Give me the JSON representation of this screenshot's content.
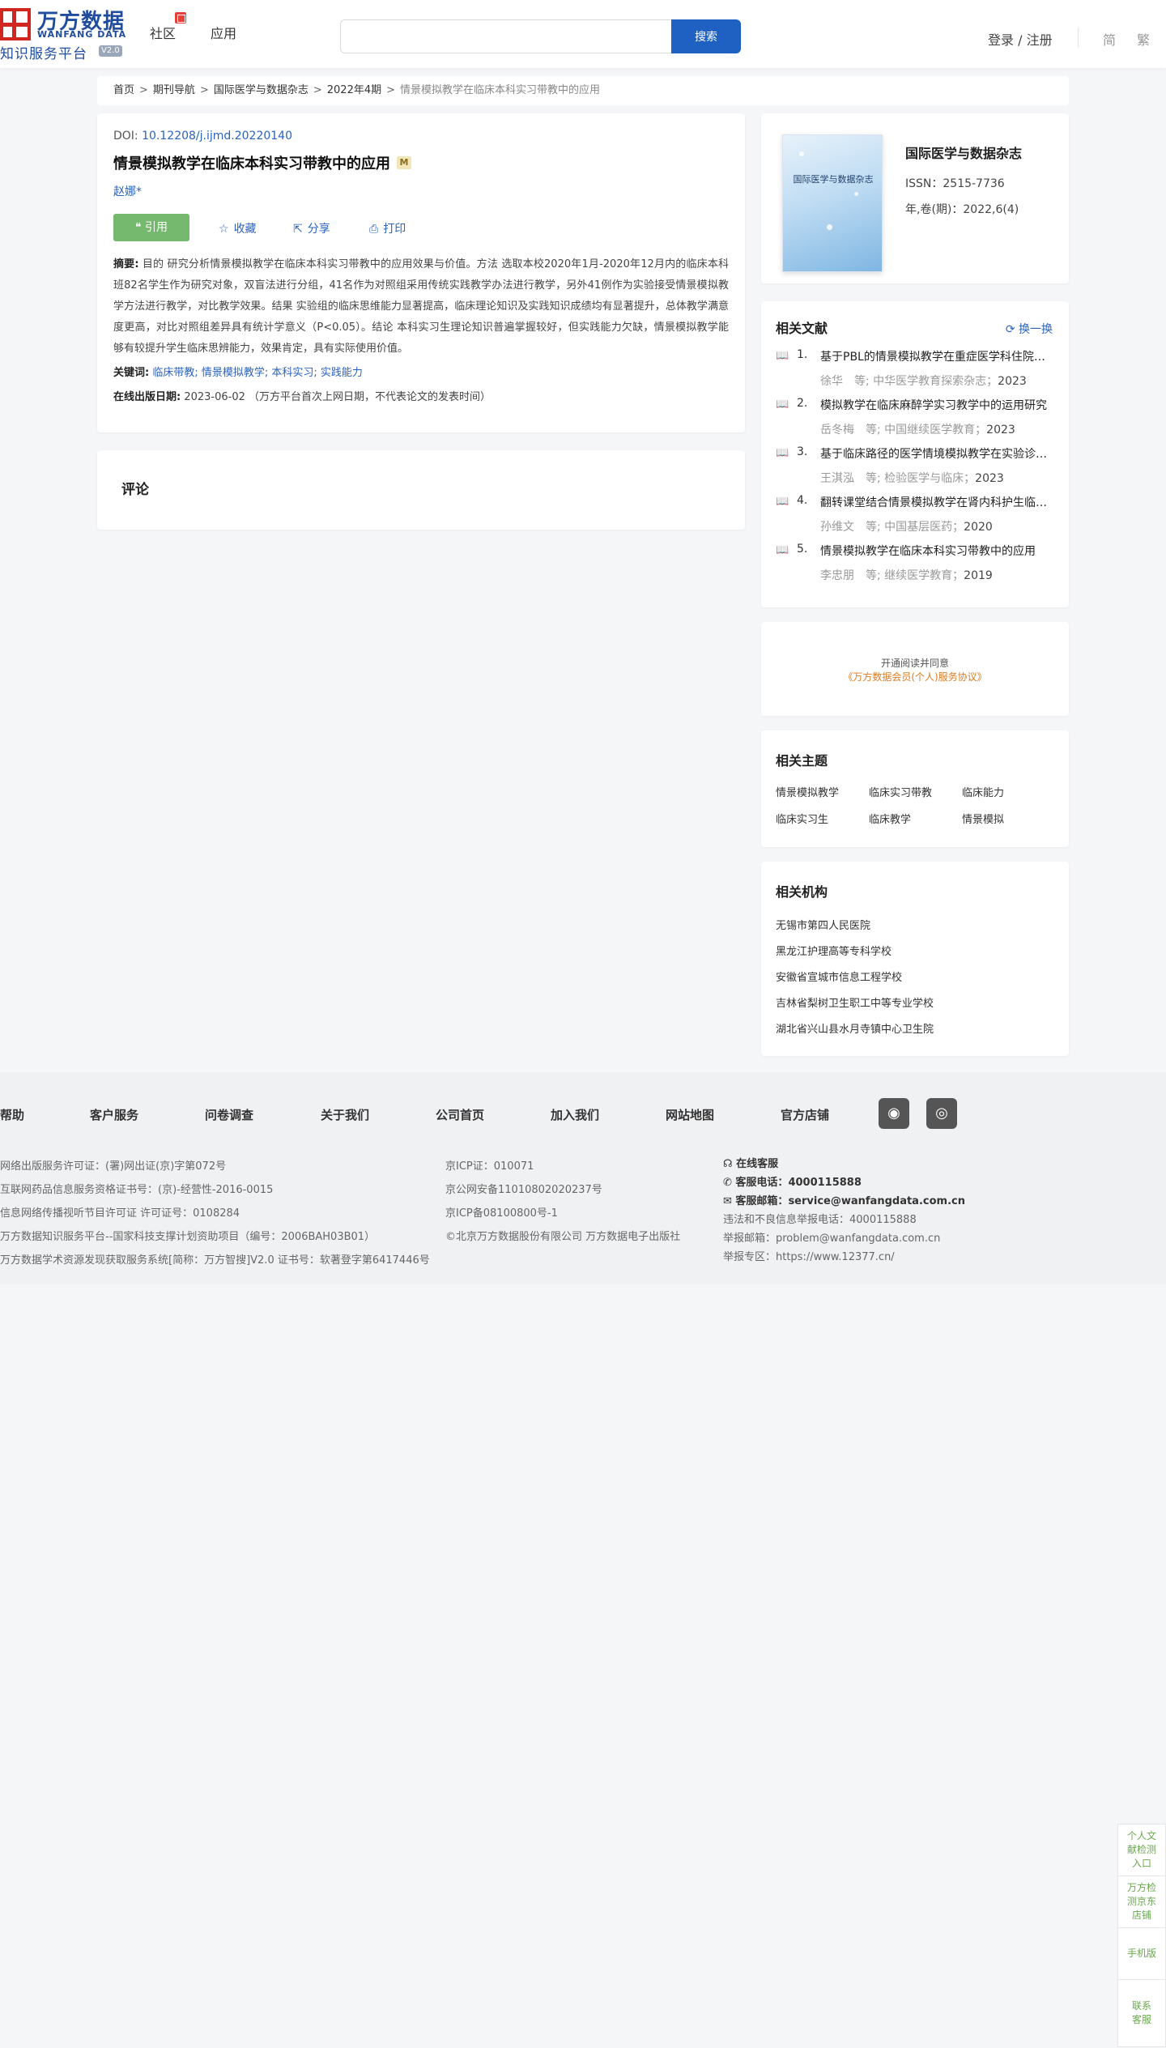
{
  "header": {
    "logo_cn": "万方数据",
    "logo_en": "WANFANG DATA",
    "logo_sub": "知识服务平台",
    "logo_version": "V2.0",
    "nav": [
      "社区",
      "应用"
    ],
    "search_placeholder": "",
    "search_button": "搜索",
    "login": "登录 / 注册",
    "lang_simplified": "简",
    "lang_traditional": "繁"
  },
  "breadcrumb": {
    "items": [
      "首页",
      "期刊导航",
      "国际医学与数据杂志",
      "2022年4期"
    ],
    "current": "情景模拟教学在临床本科实习带教中的应用",
    "separator": ">"
  },
  "article": {
    "doi_label": "DOI:",
    "doi": "10.12208/j.ijmd.20220140",
    "title": "情景模拟教学在临床本科实习带教中的应用",
    "tag": "M",
    "author": "赵娜*",
    "actions": {
      "cite": "引用",
      "favorite": "收藏",
      "share": "分享",
      "print": "打印"
    },
    "abstract_label": "摘要:",
    "abstract": "目的 研究分析情景模拟教学在临床本科实习带教中的应用效果与价值。方法 选取本校2020年1月-2020年12月内的临床本科班82名学生作为研究对象，双盲法进行分组，41名作为对照组采用传统实践教学办法进行教学，另外41例作为实验接受情景模拟教学方法进行教学，对比教学效果。结果 实验组的临床思维能力显著提高，临床理论知识及实践知识成绩均有显著提升，总体教学满意度更高，对比对照组差异具有统计学意义（P<0.05）。结论 本科实习生理论知识普遍掌握较好，但实践能力欠缺，情景模拟教学能够有较提升学生临床思辨能力，效果肯定，具有实际使用价值。",
    "keywords_label": "关键词:",
    "keywords": "临床带教; 情景模拟教学; 本科实习; 实践能力",
    "pubdate_label": "在线出版日期:",
    "pubdate": "2023-06-02 （万方平台首次上网日期，不代表论文的发表时间）"
  },
  "comment": {
    "title": "评论"
  },
  "journal": {
    "cover_title": "国际医学与数据杂志",
    "name": "国际医学与数据杂志",
    "issn": "ISSN：2515-7736",
    "volume": "年,卷(期)：2022,6(4)"
  },
  "related": {
    "title": "相关文献",
    "swap": "换一换",
    "items": [
      {
        "num": "1.",
        "title": "基于PBL的情景模拟教学在重症医学科住院医师规范化培训中的应用",
        "meta": "徐华　等;  中华医学教育探索杂志；",
        "year": "2023"
      },
      {
        "num": "2.",
        "title": "模拟教学在临床麻醉学实习教学中的运用研究",
        "meta": "岳冬梅　等;  中国继续医学教育；",
        "year": "2023"
      },
      {
        "num": "3.",
        "title": "基于临床路径的医学情境模拟教学在实验诊断学中的应用",
        "meta": "王淇泓　等;  检验医学与临床；",
        "year": "2023"
      },
      {
        "num": "4.",
        "title": "翻转课堂结合情景模拟教学在肾内科护生临床带教中的应用",
        "meta": "孙维文　等;  中国基层医药；",
        "year": "2020"
      },
      {
        "num": "5.",
        "title": "情景模拟教学在临床本科实习带教中的应用",
        "meta": "李忠朋　等;  继续医学教育；",
        "year": "2019"
      }
    ]
  },
  "agreement": {
    "line1": "开通阅读并同意",
    "line2": "《万方数据会员(个人)服务协议》"
  },
  "topics": {
    "title": "相关主题",
    "items": [
      "情景模拟教学",
      "临床实习带教",
      "临床能力",
      "临床实习生",
      "临床教学",
      "情景模拟"
    ]
  },
  "orgs": {
    "title": "相关机构",
    "items": [
      "无锡市第四人民医院",
      "黑龙江护理高等专科学校",
      "安徽省宣城市信息工程学校",
      "吉林省梨树卫生职工中等专业学校",
      "湖北省兴山县水月寺镇中心卫生院"
    ]
  },
  "footer": {
    "nav": [
      "帮助",
      "客户服务",
      "问卷调查",
      "关于我们",
      "公司首页",
      "加入我们",
      "网站地图",
      "官方店铺"
    ],
    "col1": [
      "网络出版服务许可证：(署)网出证(京)字第072号",
      "互联网药品信息服务资格证书号：(京)-经营性-2016-0015",
      "信息网络传播视听节目许可证 许可证号：0108284",
      "万方数据知识服务平台--国家科技支撑计划资助项目（编号：2006BAH03B01）",
      "万方数据学术资源发现获取服务系统[简称：万方智搜]V2.0 证书号：软著登字第6417446号"
    ],
    "col2": [
      "京ICP证：010071",
      "京公网安备11010802020237号",
      "京ICP备08100800号-1",
      "©北京万方数据股份有限公司 万方数据电子出版社"
    ],
    "online_service": "在线客服",
    "phone_label": "客服电话：",
    "phone": "4000115888",
    "email_label": "客服邮箱：",
    "email": "service@wanfangdata.com.cn",
    "report_phone": "违法和不良信息举报电话：4000115888",
    "report_email": "举报邮箱：problem@wanfangdata.com.cn",
    "report_zone": "举报专区：https://www.12377.cn/"
  },
  "float": {
    "items": [
      "个人文献检测入口",
      "万方检测京东店铺",
      "手机版",
      "联系客服"
    ]
  }
}
